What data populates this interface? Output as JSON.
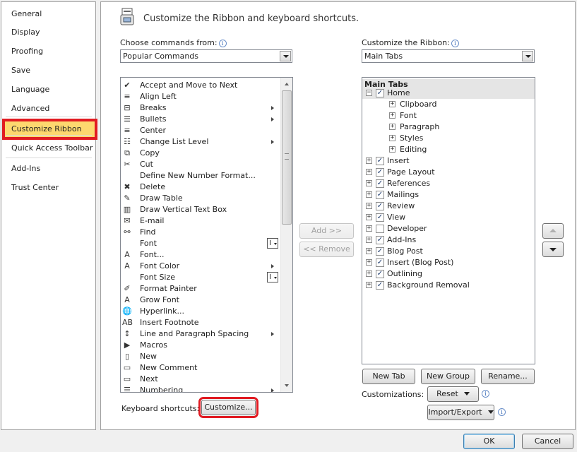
{
  "nav": {
    "items": [
      "General",
      "Display",
      "Proofing",
      "Save",
      "Language",
      "Advanced",
      "Customize Ribbon",
      "Quick Access Toolbar",
      "Add-Ins",
      "Trust Center"
    ],
    "selected": "Customize Ribbon"
  },
  "header": {
    "title": "Customize the Ribbon and keyboard shortcuts."
  },
  "left": {
    "label": "Choose commands from:",
    "combo_value": "Popular Commands",
    "commands": [
      {
        "label": "Accept and Move to Next",
        "icon": "accept-icon",
        "glyph": "✔",
        "submenu": false
      },
      {
        "label": "Align Left",
        "icon": "align-left-icon",
        "glyph": "≡",
        "submenu": false
      },
      {
        "label": "Breaks",
        "icon": "breaks-icon",
        "glyph": "⊟",
        "submenu": true
      },
      {
        "label": "Bullets",
        "icon": "bullets-icon",
        "glyph": "☰",
        "submenu": true
      },
      {
        "label": "Center",
        "icon": "align-center-icon",
        "glyph": "≡",
        "submenu": false
      },
      {
        "label": "Change List Level",
        "icon": "list-level-icon",
        "glyph": "☷",
        "submenu": true
      },
      {
        "label": "Copy",
        "icon": "copy-icon",
        "glyph": "⧉",
        "submenu": false
      },
      {
        "label": "Cut",
        "icon": "scissors-icon",
        "glyph": "✂",
        "submenu": false
      },
      {
        "label": "Define New Number Format...",
        "icon": "",
        "glyph": "",
        "submenu": false
      },
      {
        "label": "Delete",
        "icon": "delete-icon",
        "glyph": "✖",
        "submenu": false
      },
      {
        "label": "Draw Table",
        "icon": "draw-table-icon",
        "glyph": "✎",
        "submenu": false
      },
      {
        "label": "Draw Vertical Text Box",
        "icon": "text-box-icon",
        "glyph": "▥",
        "submenu": false
      },
      {
        "label": "E-mail",
        "icon": "email-icon",
        "glyph": "✉",
        "submenu": false
      },
      {
        "label": "Find",
        "icon": "binoculars-icon",
        "glyph": "⚯",
        "submenu": false
      },
      {
        "label": "Font",
        "icon": "",
        "glyph": "",
        "submenu": false,
        "ibox": true
      },
      {
        "label": "Font...",
        "icon": "font-dialog-icon",
        "glyph": "A",
        "submenu": false
      },
      {
        "label": "Font Color",
        "icon": "font-color-icon",
        "glyph": "A",
        "submenu": true
      },
      {
        "label": "Font Size",
        "icon": "",
        "glyph": "",
        "submenu": false,
        "ibox": true
      },
      {
        "label": "Format Painter",
        "icon": "paintbrush-icon",
        "glyph": "✐",
        "submenu": false
      },
      {
        "label": "Grow Font",
        "icon": "grow-font-icon",
        "glyph": "A",
        "submenu": false
      },
      {
        "label": "Hyperlink...",
        "icon": "hyperlink-icon",
        "glyph": "🌐",
        "submenu": false
      },
      {
        "label": "Insert Footnote",
        "icon": "footnote-icon",
        "glyph": "AB",
        "submenu": false
      },
      {
        "label": "Line and Paragraph Spacing",
        "icon": "line-spacing-icon",
        "glyph": "↕",
        "submenu": true
      },
      {
        "label": "Macros",
        "icon": "macros-icon",
        "glyph": "▶",
        "submenu": false
      },
      {
        "label": "New",
        "icon": "new-document-icon",
        "glyph": "▯",
        "submenu": false
      },
      {
        "label": "New Comment",
        "icon": "new-comment-icon",
        "glyph": "▭",
        "submenu": false
      },
      {
        "label": "Next",
        "icon": "next-icon",
        "glyph": "▭",
        "submenu": false
      },
      {
        "label": "Numbering",
        "icon": "numbering-icon",
        "glyph": "☰",
        "submenu": true
      }
    ],
    "keyboard_label": "Keyboard shortcuts:",
    "customize_button": "Customize..."
  },
  "middle": {
    "add": "Add >>",
    "remove": "<< Remove"
  },
  "right": {
    "label": "Customize the Ribbon:",
    "combo_value": "Main Tabs",
    "tree_header": "Main Tabs",
    "home": {
      "label": "Home",
      "checked": true,
      "groups": [
        "Clipboard",
        "Font",
        "Paragraph",
        "Styles",
        "Editing"
      ]
    },
    "tabs": [
      {
        "label": "Insert",
        "checked": true
      },
      {
        "label": "Page Layout",
        "checked": true
      },
      {
        "label": "References",
        "checked": true
      },
      {
        "label": "Mailings",
        "checked": true
      },
      {
        "label": "Review",
        "checked": true
      },
      {
        "label": "View",
        "checked": true
      },
      {
        "label": "Developer",
        "checked": false
      },
      {
        "label": "Add-Ins",
        "checked": true
      },
      {
        "label": "Blog Post",
        "checked": true
      },
      {
        "label": "Insert (Blog Post)",
        "checked": true
      },
      {
        "label": "Outlining",
        "checked": true
      },
      {
        "label": "Background Removal",
        "checked": true
      }
    ],
    "new_tab": "New Tab",
    "new_group": "New Group",
    "rename": "Rename...",
    "customizations_label": "Customizations:",
    "reset": "Reset",
    "import_export": "Import/Export"
  },
  "footer": {
    "ok": "OK",
    "cancel": "Cancel"
  },
  "colors": {
    "selected_nav": "#fdd86f",
    "highlight": "#e11b22"
  }
}
